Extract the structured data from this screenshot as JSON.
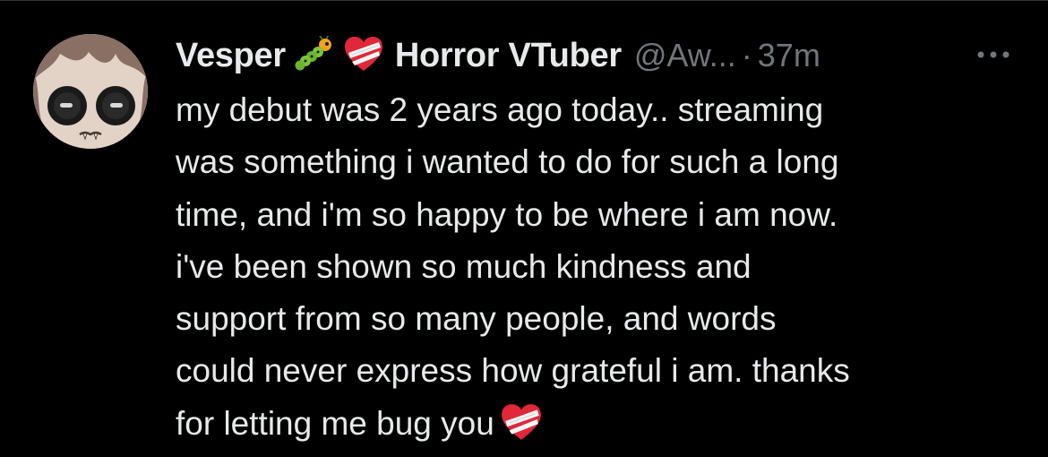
{
  "tweet": {
    "display_name": "Vesper",
    "name_emojis": [
      "caterpillar-icon",
      "mending-heart-icon"
    ],
    "name_suffix": "Horror VTuber",
    "handle": "@Aw...",
    "separator": "·",
    "timestamp": "37m",
    "more_icon": "more-dots-icon",
    "text_lines": [
      "my debut was 2 years ago today.. streaming",
      "was something i wanted to do for such a long",
      "time, and i'm so happy to be where i am now.",
      "i've been shown so much kindness and",
      "support from so many people, and words",
      "could never express how grateful i am. thanks",
      "for letting me bug you"
    ],
    "trailing_emoji": "mending-heart-icon"
  },
  "colors": {
    "background": "#000000",
    "primary_text": "#e7e9ea",
    "secondary_text": "#71767b"
  }
}
